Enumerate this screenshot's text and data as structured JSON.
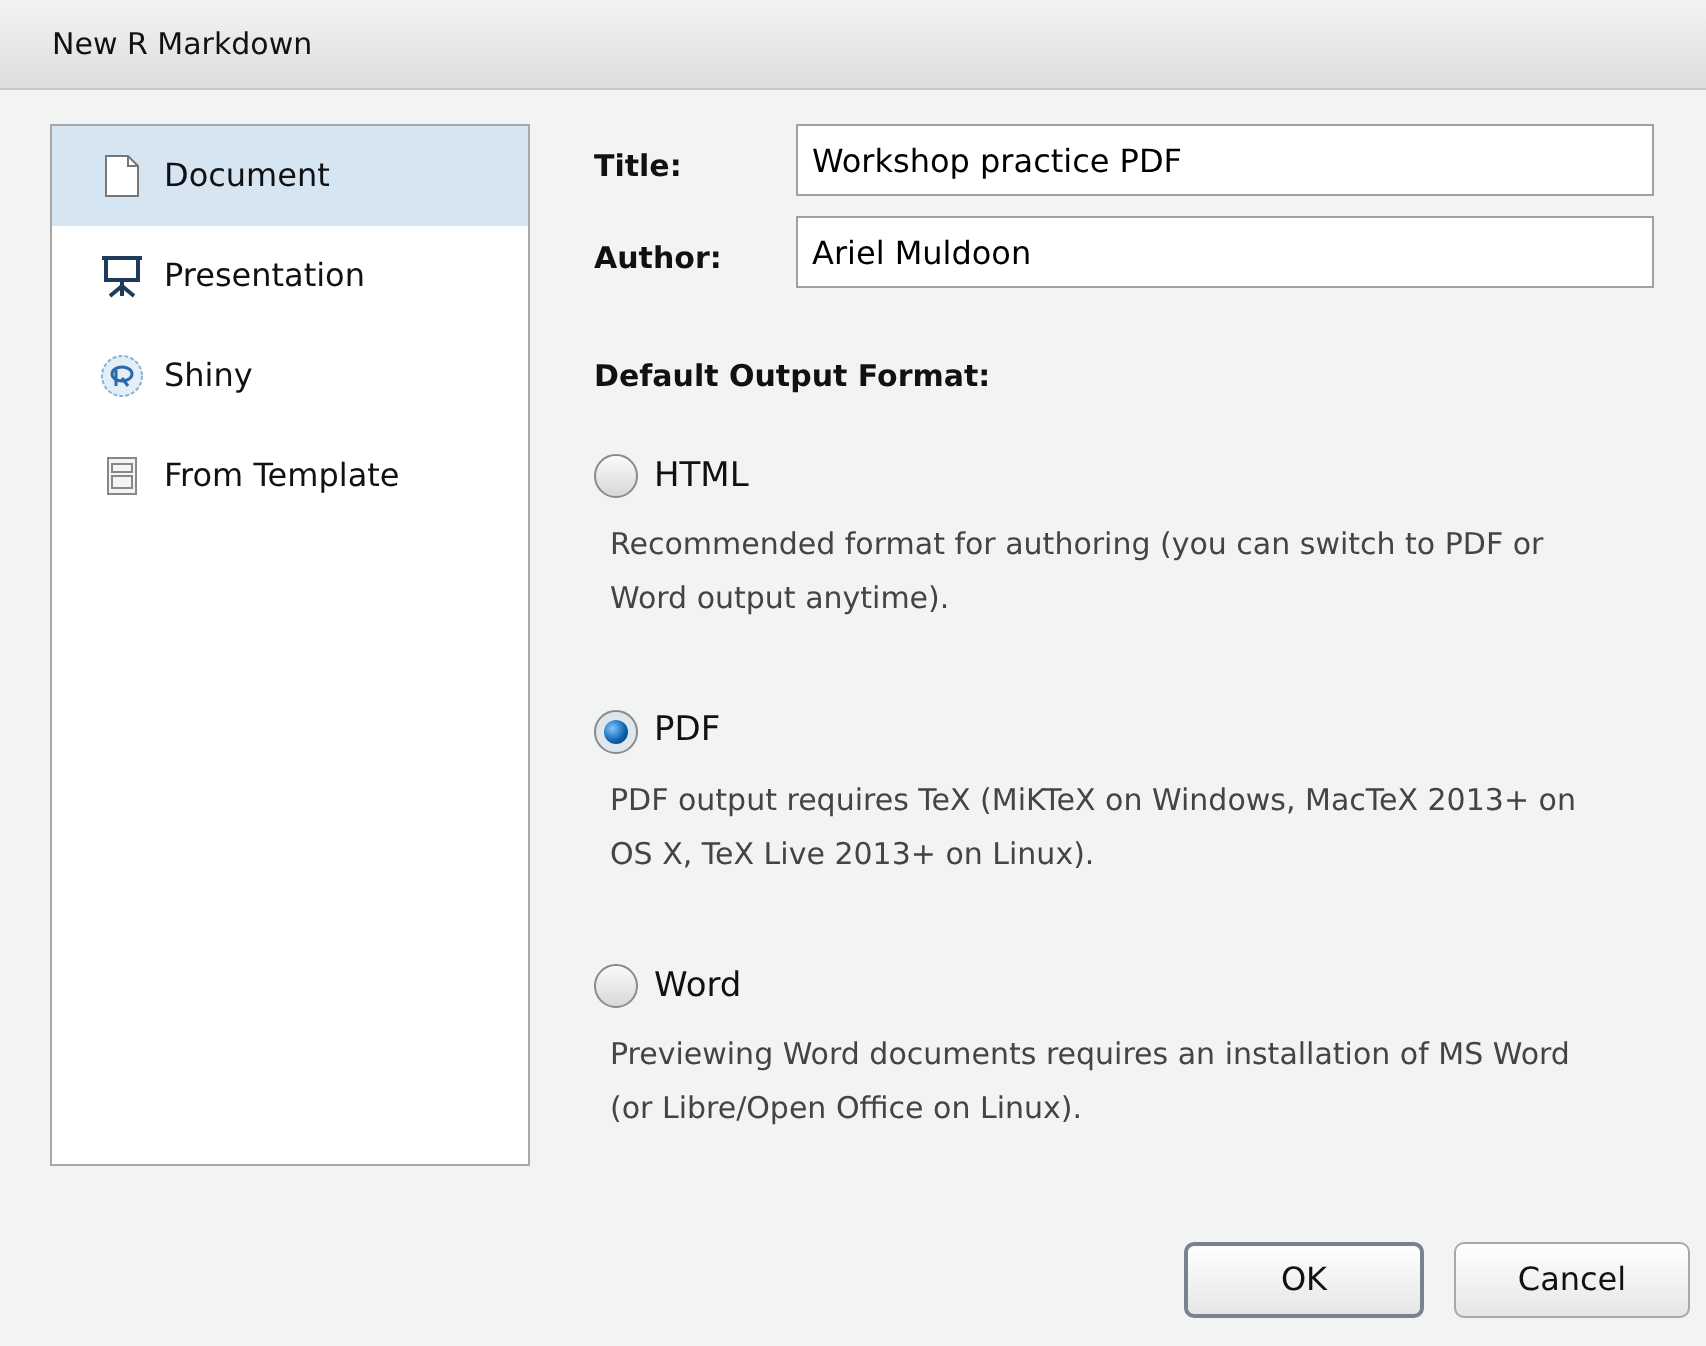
{
  "window": {
    "title": "New R Markdown"
  },
  "sidebar": {
    "items": [
      {
        "label": "Document",
        "kind": "document",
        "selected": true
      },
      {
        "label": "Presentation",
        "kind": "presentation",
        "selected": false
      },
      {
        "label": "Shiny",
        "kind": "shiny",
        "selected": false
      },
      {
        "label": "From Template",
        "kind": "template",
        "selected": false
      }
    ]
  },
  "fields": [
    {
      "label": "Title:",
      "value": "Workshop practice PDF"
    },
    {
      "label": "Author:",
      "value": "Ariel Muldoon"
    }
  ],
  "output_format": {
    "heading": "Default Output Format:",
    "options": [
      {
        "label": "HTML",
        "selected": false,
        "description": "Recommended format for authoring (you can switch to PDF or Word output anytime)."
      },
      {
        "label": "PDF",
        "selected": true,
        "description": "PDF output requires TeX (MiKTeX on Windows, MacTeX 2013+ on OS X, TeX Live 2013+ on Linux)."
      },
      {
        "label": "Word",
        "selected": false,
        "description": "Previewing Word documents requires an installation of MS Word (or Libre/Open Office on Linux)."
      }
    ]
  },
  "buttons": [
    {
      "label": "OK",
      "kind": "default"
    },
    {
      "label": "Cancel",
      "kind": "normal"
    }
  ]
}
